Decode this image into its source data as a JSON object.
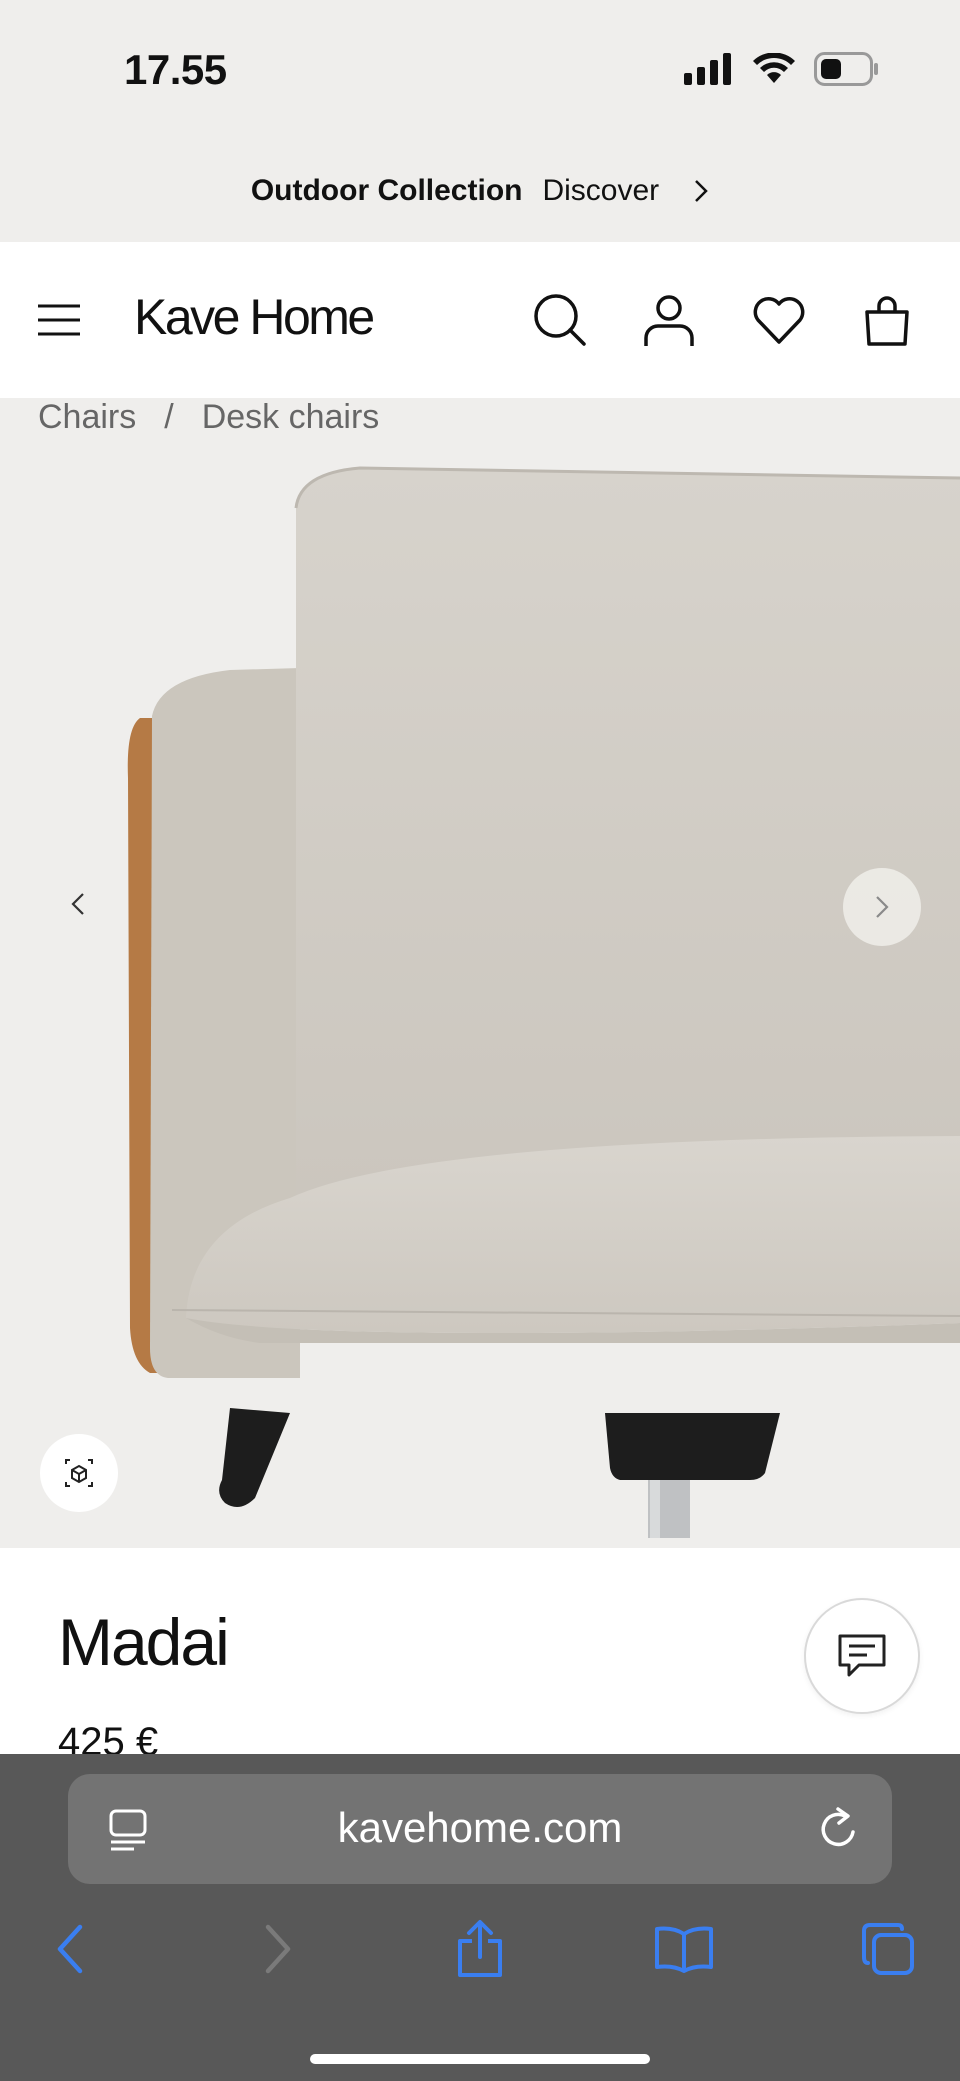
{
  "status_bar": {
    "time": "17.55"
  },
  "promo": {
    "title": "Outdoor Collection",
    "link": "Discover"
  },
  "header": {
    "logo": "Kave Home"
  },
  "breadcrumb": {
    "items": [
      "Chairs",
      "Desk chairs"
    ],
    "separator": "/"
  },
  "gallery": {
    "current_slide_fraction": 0.09
  },
  "product": {
    "name": "Madai",
    "price": "425 €"
  },
  "browser": {
    "url": "kavehome.com"
  },
  "colors": {
    "accent_blue": "#3a7ef0",
    "background": "#efeeec",
    "header_bg": "#ffffff"
  }
}
